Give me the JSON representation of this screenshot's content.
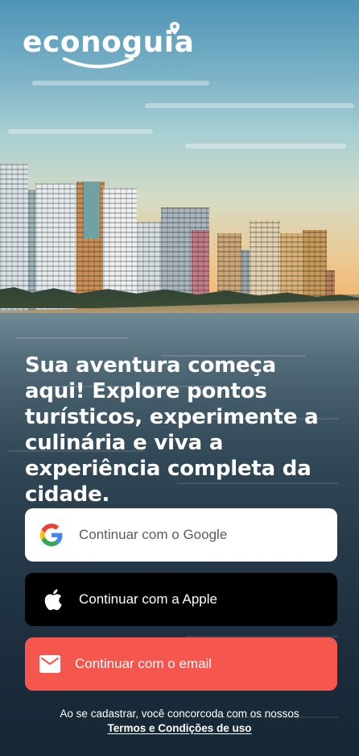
{
  "brand": {
    "name": "econoguia",
    "logo_icons": [
      "smile-curve-icon",
      "location-pin-icon"
    ]
  },
  "hero": {
    "headline": "Sua aventura começa aqui! Explore pontos turísticos, experimente a culinária e viva a experiência completa da cidade."
  },
  "auth": {
    "google_label": "Continuar com o Google",
    "google_icon": "google-icon",
    "apple_label": "Continuar com a Apple",
    "apple_icon": "apple-icon",
    "email_label": "Continuar com o email",
    "email_icon": "envelope-icon"
  },
  "legal": {
    "text": "Ao se cadastrar, você concorcoda com os nossos",
    "terms_link": "Termos e Condições de uso"
  },
  "colors": {
    "google_bg": "#ffffff",
    "apple_bg": "#000000",
    "email_bg": "#f5564e",
    "text_light": "#ffffff"
  }
}
